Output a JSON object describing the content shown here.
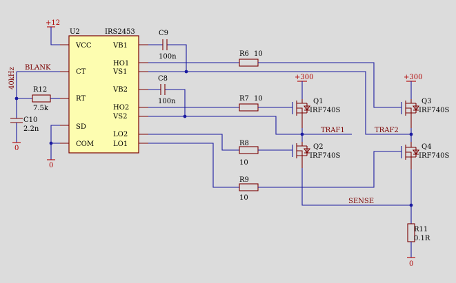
{
  "ic": {
    "ref": "U2",
    "part": "IRS2453",
    "pins_left": [
      "VCC",
      "CT",
      "RT",
      "SD",
      "COM"
    ],
    "pins_right": [
      "VB1",
      "HO1",
      "VS1",
      "VB2",
      "HO2",
      "VS2",
      "LO2",
      "LO1"
    ]
  },
  "power": {
    "v12": "+12",
    "v300_a": "+300",
    "v300_b": "+300",
    "gnd": "0"
  },
  "nets": {
    "blank": "BLANK",
    "traf1": "TRAF1",
    "traf2": "TRAF2",
    "sense": "SENSE",
    "freq": "40kHz"
  },
  "components": {
    "c9": {
      "ref": "C9",
      "value": "100n"
    },
    "c8": {
      "ref": "C8",
      "value": "100n"
    },
    "c10": {
      "ref": "C10",
      "value": "2.2n"
    },
    "r12": {
      "ref": "R12",
      "value": "7.5k"
    },
    "r6": {
      "ref": "R6",
      "value": "10"
    },
    "r7": {
      "ref": "R7",
      "value": "10"
    },
    "r8": {
      "ref": "R8",
      "value": "10"
    },
    "r9": {
      "ref": "R9",
      "value": "10"
    },
    "r11": {
      "ref": "R11",
      "value": "0.1R"
    },
    "q1": {
      "ref": "Q1",
      "part": "IRF740S"
    },
    "q2": {
      "ref": "Q2",
      "part": "IRF740S"
    },
    "q3": {
      "ref": "Q3",
      "part": "IRF740S"
    },
    "q4": {
      "ref": "Q4",
      "part": "IRF740S"
    }
  },
  "colors": {
    "background": "#dcdcdc",
    "wire": "#1a1aa0",
    "ic_fill": "#fdfdb0",
    "part_line": "#7a0000",
    "label": "#000000"
  }
}
